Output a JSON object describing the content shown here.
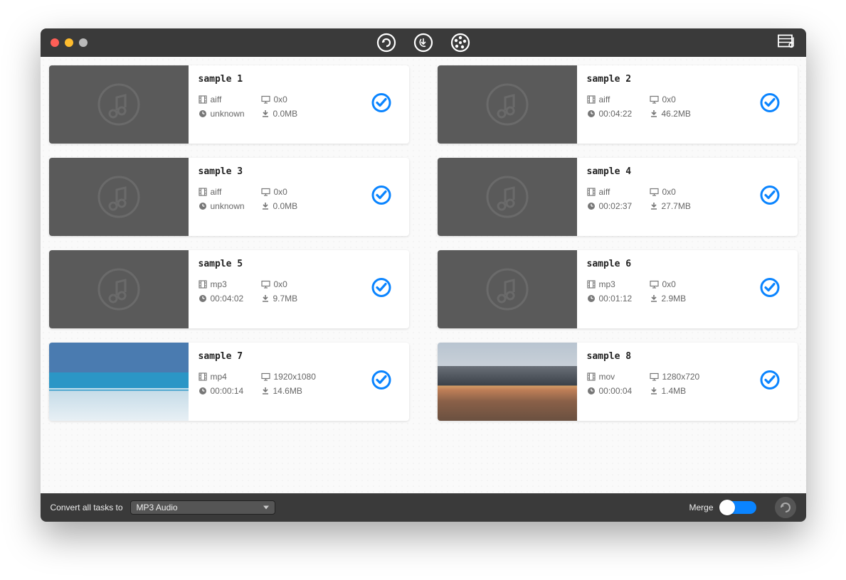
{
  "footer": {
    "convert_label": "Convert all tasks to",
    "format_selected": "MP3 Audio",
    "merge_label": "Merge"
  },
  "items": [
    {
      "name": "sample 1",
      "format": "aiff",
      "resolution": "0x0",
      "duration": "unknown",
      "size": "0.0MB",
      "thumb": "audio"
    },
    {
      "name": "sample 2",
      "format": "aiff",
      "resolution": "0x0",
      "duration": "00:04:22",
      "size": "46.2MB",
      "thumb": "audio"
    },
    {
      "name": "sample 3",
      "format": "aiff",
      "resolution": "0x0",
      "duration": "unknown",
      "size": "0.0MB",
      "thumb": "audio"
    },
    {
      "name": "sample 4",
      "format": "aiff",
      "resolution": "0x0",
      "duration": "00:02:37",
      "size": "27.7MB",
      "thumb": "audio"
    },
    {
      "name": "sample 5",
      "format": "mp3",
      "resolution": "0x0",
      "duration": "00:04:02",
      "size": "9.7MB",
      "thumb": "audio"
    },
    {
      "name": "sample 6",
      "format": "mp3",
      "resolution": "0x0",
      "duration": "00:01:12",
      "size": "2.9MB",
      "thumb": "audio"
    },
    {
      "name": "sample 7",
      "format": "mp4",
      "resolution": "1920x1080",
      "duration": "00:00:14",
      "size": "14.6MB",
      "thumb": "video1"
    },
    {
      "name": "sample 8",
      "format": "mov",
      "resolution": "1280x720",
      "duration": "00:00:04",
      "size": "1.4MB",
      "thumb": "video2"
    }
  ]
}
